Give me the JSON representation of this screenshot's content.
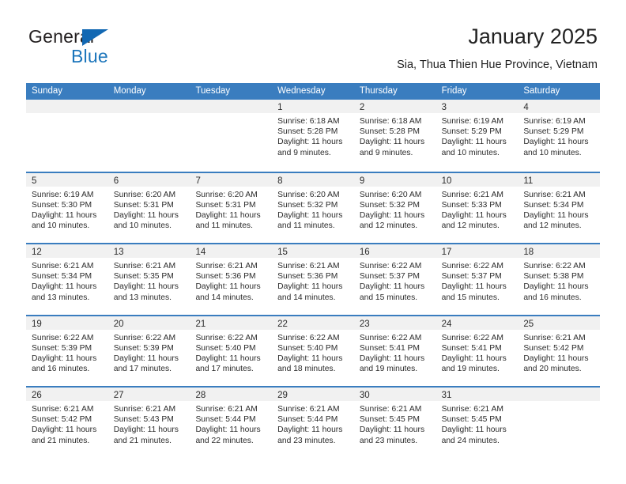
{
  "brand": {
    "name_top": "General",
    "name_bottom": "Blue",
    "triangle_color": "#1268b3",
    "blue_color": "#1b75bb"
  },
  "header": {
    "title": "January 2025",
    "subtitle": "Sia, Thua Thien Hue Province, Vietnam"
  },
  "theme": {
    "header_bar": "#3a7dbf",
    "day_band": "#f1f1f1",
    "text": "#2b2b2b"
  },
  "weekdays": [
    "Sunday",
    "Monday",
    "Tuesday",
    "Wednesday",
    "Thursday",
    "Friday",
    "Saturday"
  ],
  "weeks": [
    [
      {
        "day": "",
        "empty": true
      },
      {
        "day": "",
        "empty": true
      },
      {
        "day": "",
        "empty": true
      },
      {
        "day": "1",
        "sunrise": "Sunrise: 6:18 AM",
        "sunset": "Sunset: 5:28 PM",
        "daylight1": "Daylight: 11 hours",
        "daylight2": "and 9 minutes."
      },
      {
        "day": "2",
        "sunrise": "Sunrise: 6:18 AM",
        "sunset": "Sunset: 5:28 PM",
        "daylight1": "Daylight: 11 hours",
        "daylight2": "and 9 minutes."
      },
      {
        "day": "3",
        "sunrise": "Sunrise: 6:19 AM",
        "sunset": "Sunset: 5:29 PM",
        "daylight1": "Daylight: 11 hours",
        "daylight2": "and 10 minutes."
      },
      {
        "day": "4",
        "sunrise": "Sunrise: 6:19 AM",
        "sunset": "Sunset: 5:29 PM",
        "daylight1": "Daylight: 11 hours",
        "daylight2": "and 10 minutes."
      }
    ],
    [
      {
        "day": "5",
        "sunrise": "Sunrise: 6:19 AM",
        "sunset": "Sunset: 5:30 PM",
        "daylight1": "Daylight: 11 hours",
        "daylight2": "and 10 minutes."
      },
      {
        "day": "6",
        "sunrise": "Sunrise: 6:20 AM",
        "sunset": "Sunset: 5:31 PM",
        "daylight1": "Daylight: 11 hours",
        "daylight2": "and 10 minutes."
      },
      {
        "day": "7",
        "sunrise": "Sunrise: 6:20 AM",
        "sunset": "Sunset: 5:31 PM",
        "daylight1": "Daylight: 11 hours",
        "daylight2": "and 11 minutes."
      },
      {
        "day": "8",
        "sunrise": "Sunrise: 6:20 AM",
        "sunset": "Sunset: 5:32 PM",
        "daylight1": "Daylight: 11 hours",
        "daylight2": "and 11 minutes."
      },
      {
        "day": "9",
        "sunrise": "Sunrise: 6:20 AM",
        "sunset": "Sunset: 5:32 PM",
        "daylight1": "Daylight: 11 hours",
        "daylight2": "and 12 minutes."
      },
      {
        "day": "10",
        "sunrise": "Sunrise: 6:21 AM",
        "sunset": "Sunset: 5:33 PM",
        "daylight1": "Daylight: 11 hours",
        "daylight2": "and 12 minutes."
      },
      {
        "day": "11",
        "sunrise": "Sunrise: 6:21 AM",
        "sunset": "Sunset: 5:34 PM",
        "daylight1": "Daylight: 11 hours",
        "daylight2": "and 12 minutes."
      }
    ],
    [
      {
        "day": "12",
        "sunrise": "Sunrise: 6:21 AM",
        "sunset": "Sunset: 5:34 PM",
        "daylight1": "Daylight: 11 hours",
        "daylight2": "and 13 minutes."
      },
      {
        "day": "13",
        "sunrise": "Sunrise: 6:21 AM",
        "sunset": "Sunset: 5:35 PM",
        "daylight1": "Daylight: 11 hours",
        "daylight2": "and 13 minutes."
      },
      {
        "day": "14",
        "sunrise": "Sunrise: 6:21 AM",
        "sunset": "Sunset: 5:36 PM",
        "daylight1": "Daylight: 11 hours",
        "daylight2": "and 14 minutes."
      },
      {
        "day": "15",
        "sunrise": "Sunrise: 6:21 AM",
        "sunset": "Sunset: 5:36 PM",
        "daylight1": "Daylight: 11 hours",
        "daylight2": "and 14 minutes."
      },
      {
        "day": "16",
        "sunrise": "Sunrise: 6:22 AM",
        "sunset": "Sunset: 5:37 PM",
        "daylight1": "Daylight: 11 hours",
        "daylight2": "and 15 minutes."
      },
      {
        "day": "17",
        "sunrise": "Sunrise: 6:22 AM",
        "sunset": "Sunset: 5:37 PM",
        "daylight1": "Daylight: 11 hours",
        "daylight2": "and 15 minutes."
      },
      {
        "day": "18",
        "sunrise": "Sunrise: 6:22 AM",
        "sunset": "Sunset: 5:38 PM",
        "daylight1": "Daylight: 11 hours",
        "daylight2": "and 16 minutes."
      }
    ],
    [
      {
        "day": "19",
        "sunrise": "Sunrise: 6:22 AM",
        "sunset": "Sunset: 5:39 PM",
        "daylight1": "Daylight: 11 hours",
        "daylight2": "and 16 minutes."
      },
      {
        "day": "20",
        "sunrise": "Sunrise: 6:22 AM",
        "sunset": "Sunset: 5:39 PM",
        "daylight1": "Daylight: 11 hours",
        "daylight2": "and 17 minutes."
      },
      {
        "day": "21",
        "sunrise": "Sunrise: 6:22 AM",
        "sunset": "Sunset: 5:40 PM",
        "daylight1": "Daylight: 11 hours",
        "daylight2": "and 17 minutes."
      },
      {
        "day": "22",
        "sunrise": "Sunrise: 6:22 AM",
        "sunset": "Sunset: 5:40 PM",
        "daylight1": "Daylight: 11 hours",
        "daylight2": "and 18 minutes."
      },
      {
        "day": "23",
        "sunrise": "Sunrise: 6:22 AM",
        "sunset": "Sunset: 5:41 PM",
        "daylight1": "Daylight: 11 hours",
        "daylight2": "and 19 minutes."
      },
      {
        "day": "24",
        "sunrise": "Sunrise: 6:22 AM",
        "sunset": "Sunset: 5:41 PM",
        "daylight1": "Daylight: 11 hours",
        "daylight2": "and 19 minutes."
      },
      {
        "day": "25",
        "sunrise": "Sunrise: 6:21 AM",
        "sunset": "Sunset: 5:42 PM",
        "daylight1": "Daylight: 11 hours",
        "daylight2": "and 20 minutes."
      }
    ],
    [
      {
        "day": "26",
        "sunrise": "Sunrise: 6:21 AM",
        "sunset": "Sunset: 5:42 PM",
        "daylight1": "Daylight: 11 hours",
        "daylight2": "and 21 minutes."
      },
      {
        "day": "27",
        "sunrise": "Sunrise: 6:21 AM",
        "sunset": "Sunset: 5:43 PM",
        "daylight1": "Daylight: 11 hours",
        "daylight2": "and 21 minutes."
      },
      {
        "day": "28",
        "sunrise": "Sunrise: 6:21 AM",
        "sunset": "Sunset: 5:44 PM",
        "daylight1": "Daylight: 11 hours",
        "daylight2": "and 22 minutes."
      },
      {
        "day": "29",
        "sunrise": "Sunrise: 6:21 AM",
        "sunset": "Sunset: 5:44 PM",
        "daylight1": "Daylight: 11 hours",
        "daylight2": "and 23 minutes."
      },
      {
        "day": "30",
        "sunrise": "Sunrise: 6:21 AM",
        "sunset": "Sunset: 5:45 PM",
        "daylight1": "Daylight: 11 hours",
        "daylight2": "and 23 minutes."
      },
      {
        "day": "31",
        "sunrise": "Sunrise: 6:21 AM",
        "sunset": "Sunset: 5:45 PM",
        "daylight1": "Daylight: 11 hours",
        "daylight2": "and 24 minutes."
      },
      {
        "day": "",
        "empty": true
      }
    ]
  ]
}
